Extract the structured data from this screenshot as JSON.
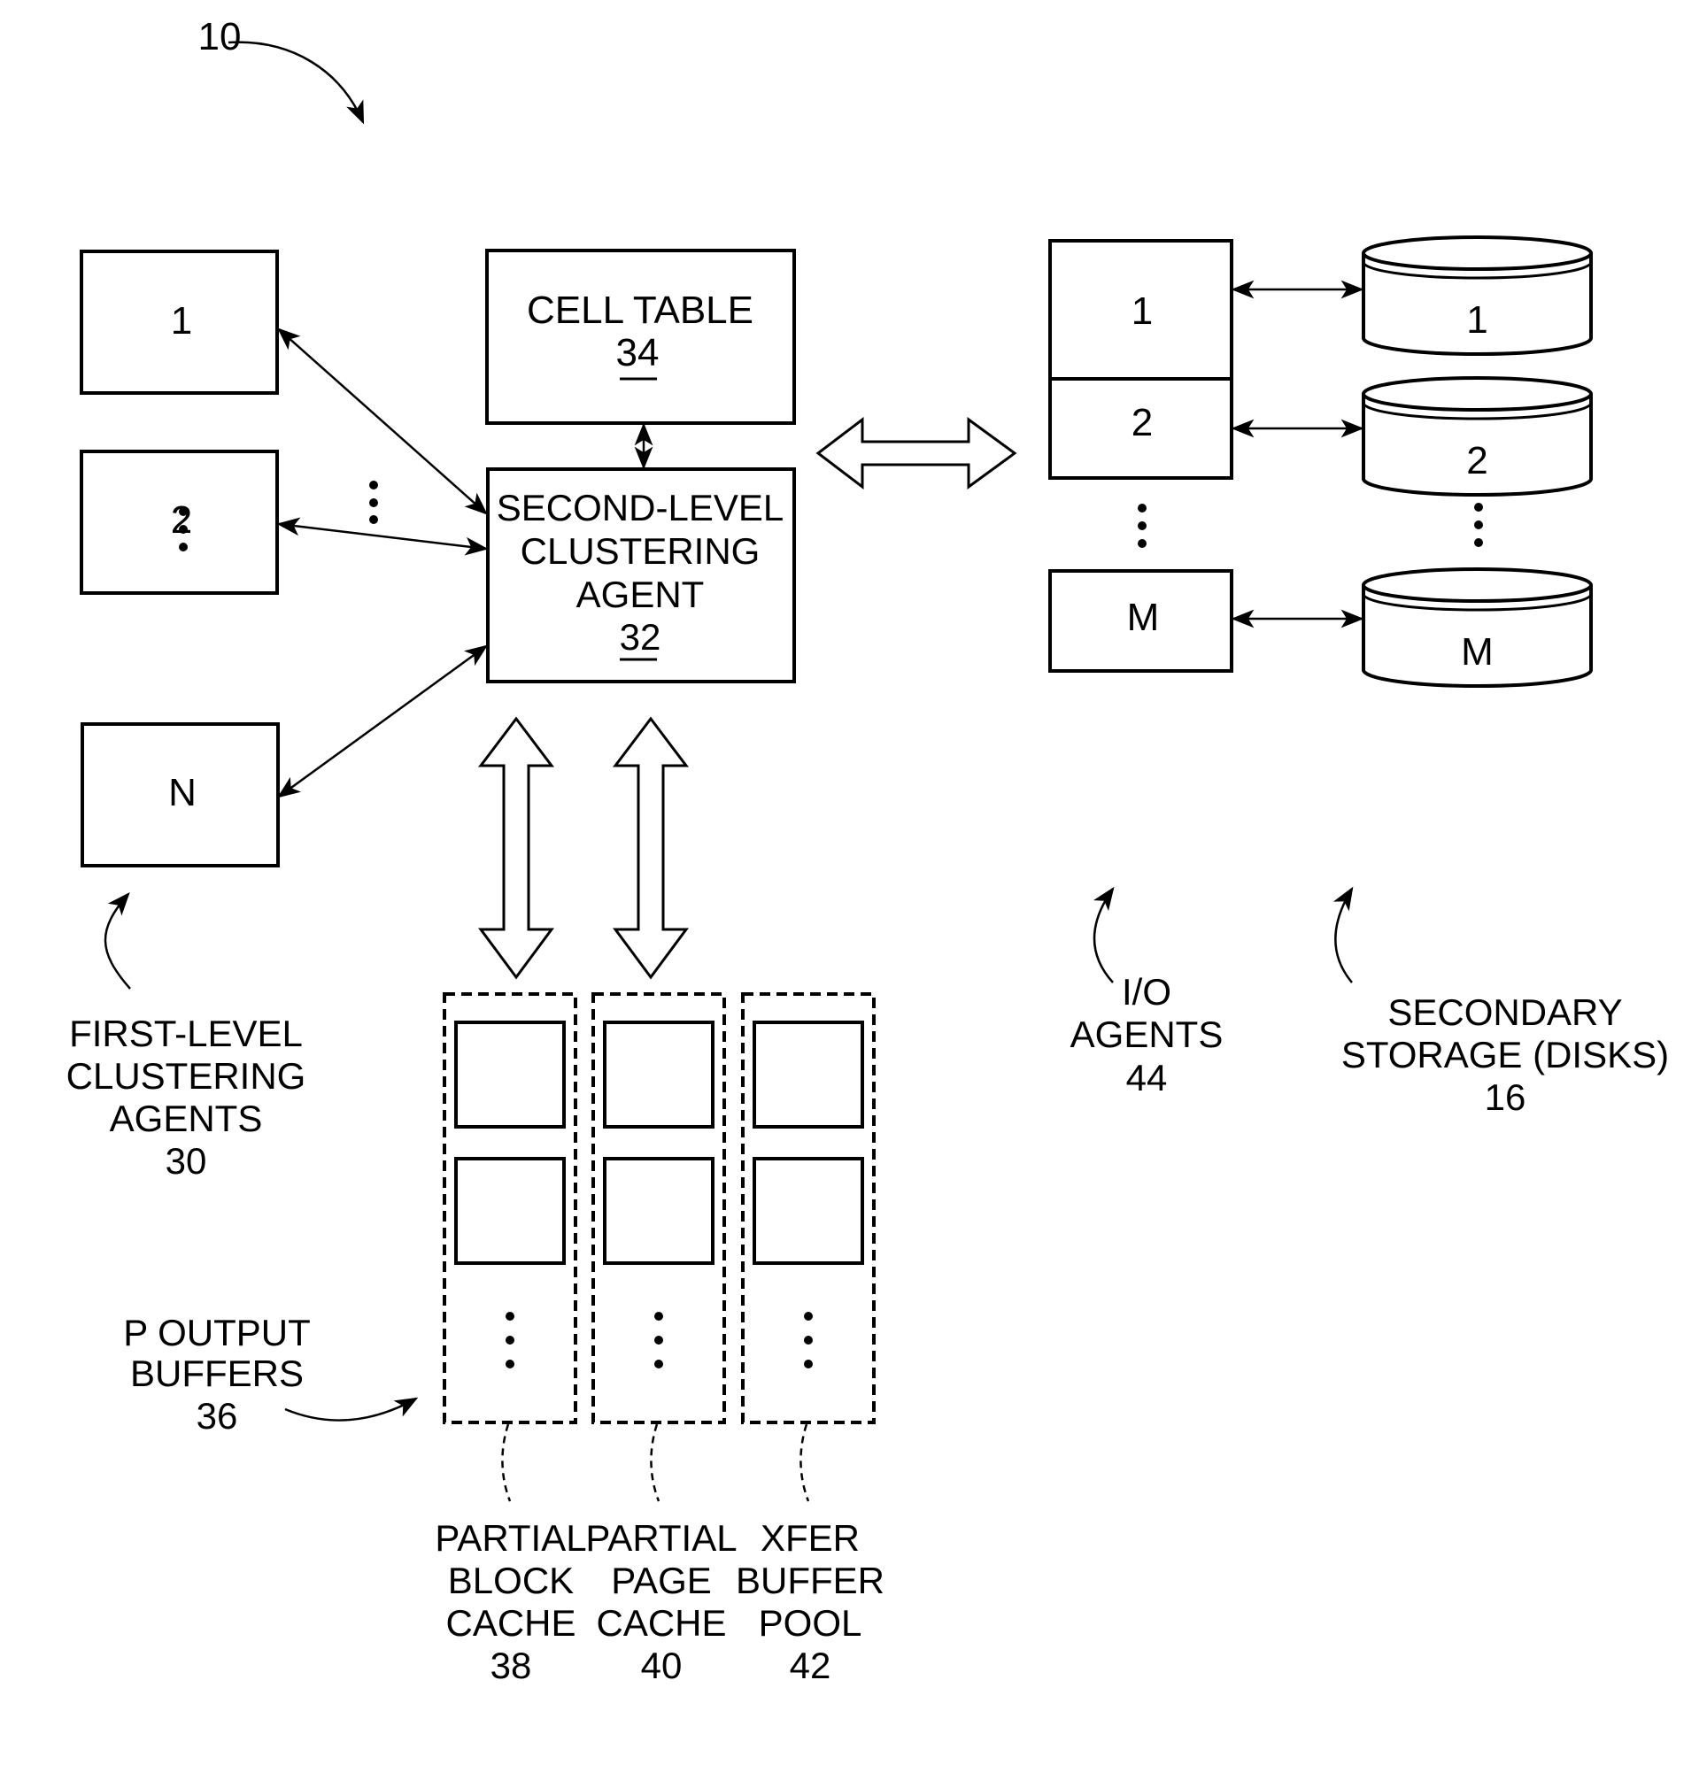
{
  "figure": {
    "ref": "10"
  },
  "cell_table": {
    "title": "CELL TABLE",
    "ref": "34"
  },
  "second_level_agent": {
    "lines": [
      "SECOND-LEVEL",
      "CLUSTERING",
      "AGENT"
    ],
    "ref": "32"
  },
  "first_level_agents": {
    "boxes": [
      "1",
      "2",
      "N"
    ],
    "label_lines": [
      "FIRST-LEVEL",
      "CLUSTERING",
      "AGENTS"
    ],
    "ref": "30"
  },
  "io_agents": {
    "boxes": [
      "1",
      "2",
      "M"
    ],
    "label_lines": [
      "I/O",
      "AGENTS"
    ],
    "ref": "44"
  },
  "disks": {
    "items": [
      "1",
      "2",
      "M"
    ],
    "label_lines": [
      "SECONDARY",
      "STORAGE (DISKS)"
    ],
    "ref": "16"
  },
  "output_buffers": {
    "label_lines": [
      "P OUTPUT",
      "BUFFERS"
    ],
    "ref": "36",
    "pools": [
      {
        "label_lines": [
          "PARTIAL",
          "BLOCK",
          "CACHE"
        ],
        "ref": "38"
      },
      {
        "label_lines": [
          "PARTIAL",
          "PAGE",
          "CACHE"
        ],
        "ref": "40"
      },
      {
        "label_lines": [
          "XFER",
          "BUFFER",
          "POOL"
        ],
        "ref": "42"
      }
    ]
  }
}
